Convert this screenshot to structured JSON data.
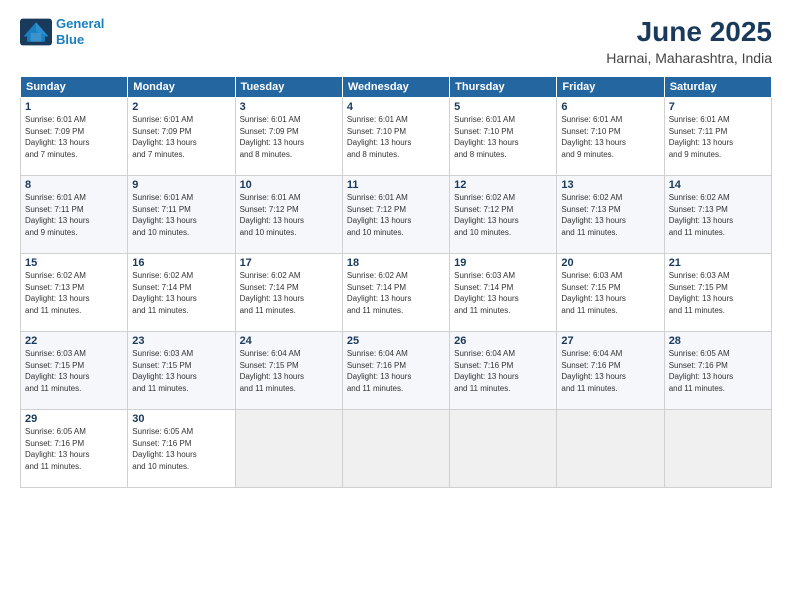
{
  "header": {
    "logo_line1": "General",
    "logo_line2": "Blue",
    "title": "June 2025",
    "subtitle": "Harnai, Maharashtra, India"
  },
  "weekdays": [
    "Sunday",
    "Monday",
    "Tuesday",
    "Wednesday",
    "Thursday",
    "Friday",
    "Saturday"
  ],
  "weeks": [
    [
      {
        "day": "1",
        "info": "Sunrise: 6:01 AM\nSunset: 7:09 PM\nDaylight: 13 hours\nand 7 minutes."
      },
      {
        "day": "2",
        "info": "Sunrise: 6:01 AM\nSunset: 7:09 PM\nDaylight: 13 hours\nand 7 minutes."
      },
      {
        "day": "3",
        "info": "Sunrise: 6:01 AM\nSunset: 7:09 PM\nDaylight: 13 hours\nand 8 minutes."
      },
      {
        "day": "4",
        "info": "Sunrise: 6:01 AM\nSunset: 7:10 PM\nDaylight: 13 hours\nand 8 minutes."
      },
      {
        "day": "5",
        "info": "Sunrise: 6:01 AM\nSunset: 7:10 PM\nDaylight: 13 hours\nand 8 minutes."
      },
      {
        "day": "6",
        "info": "Sunrise: 6:01 AM\nSunset: 7:10 PM\nDaylight: 13 hours\nand 9 minutes."
      },
      {
        "day": "7",
        "info": "Sunrise: 6:01 AM\nSunset: 7:11 PM\nDaylight: 13 hours\nand 9 minutes."
      }
    ],
    [
      {
        "day": "8",
        "info": "Sunrise: 6:01 AM\nSunset: 7:11 PM\nDaylight: 13 hours\nand 9 minutes."
      },
      {
        "day": "9",
        "info": "Sunrise: 6:01 AM\nSunset: 7:11 PM\nDaylight: 13 hours\nand 10 minutes."
      },
      {
        "day": "10",
        "info": "Sunrise: 6:01 AM\nSunset: 7:12 PM\nDaylight: 13 hours\nand 10 minutes."
      },
      {
        "day": "11",
        "info": "Sunrise: 6:01 AM\nSunset: 7:12 PM\nDaylight: 13 hours\nand 10 minutes."
      },
      {
        "day": "12",
        "info": "Sunrise: 6:02 AM\nSunset: 7:12 PM\nDaylight: 13 hours\nand 10 minutes."
      },
      {
        "day": "13",
        "info": "Sunrise: 6:02 AM\nSunset: 7:13 PM\nDaylight: 13 hours\nand 11 minutes."
      },
      {
        "day": "14",
        "info": "Sunrise: 6:02 AM\nSunset: 7:13 PM\nDaylight: 13 hours\nand 11 minutes."
      }
    ],
    [
      {
        "day": "15",
        "info": "Sunrise: 6:02 AM\nSunset: 7:13 PM\nDaylight: 13 hours\nand 11 minutes."
      },
      {
        "day": "16",
        "info": "Sunrise: 6:02 AM\nSunset: 7:14 PM\nDaylight: 13 hours\nand 11 minutes."
      },
      {
        "day": "17",
        "info": "Sunrise: 6:02 AM\nSunset: 7:14 PM\nDaylight: 13 hours\nand 11 minutes."
      },
      {
        "day": "18",
        "info": "Sunrise: 6:02 AM\nSunset: 7:14 PM\nDaylight: 13 hours\nand 11 minutes."
      },
      {
        "day": "19",
        "info": "Sunrise: 6:03 AM\nSunset: 7:14 PM\nDaylight: 13 hours\nand 11 minutes."
      },
      {
        "day": "20",
        "info": "Sunrise: 6:03 AM\nSunset: 7:15 PM\nDaylight: 13 hours\nand 11 minutes."
      },
      {
        "day": "21",
        "info": "Sunrise: 6:03 AM\nSunset: 7:15 PM\nDaylight: 13 hours\nand 11 minutes."
      }
    ],
    [
      {
        "day": "22",
        "info": "Sunrise: 6:03 AM\nSunset: 7:15 PM\nDaylight: 13 hours\nand 11 minutes."
      },
      {
        "day": "23",
        "info": "Sunrise: 6:03 AM\nSunset: 7:15 PM\nDaylight: 13 hours\nand 11 minutes."
      },
      {
        "day": "24",
        "info": "Sunrise: 6:04 AM\nSunset: 7:15 PM\nDaylight: 13 hours\nand 11 minutes."
      },
      {
        "day": "25",
        "info": "Sunrise: 6:04 AM\nSunset: 7:16 PM\nDaylight: 13 hours\nand 11 minutes."
      },
      {
        "day": "26",
        "info": "Sunrise: 6:04 AM\nSunset: 7:16 PM\nDaylight: 13 hours\nand 11 minutes."
      },
      {
        "day": "27",
        "info": "Sunrise: 6:04 AM\nSunset: 7:16 PM\nDaylight: 13 hours\nand 11 minutes."
      },
      {
        "day": "28",
        "info": "Sunrise: 6:05 AM\nSunset: 7:16 PM\nDaylight: 13 hours\nand 11 minutes."
      }
    ],
    [
      {
        "day": "29",
        "info": "Sunrise: 6:05 AM\nSunset: 7:16 PM\nDaylight: 13 hours\nand 11 minutes."
      },
      {
        "day": "30",
        "info": "Sunrise: 6:05 AM\nSunset: 7:16 PM\nDaylight: 13 hours\nand 10 minutes."
      },
      {
        "day": "",
        "info": ""
      },
      {
        "day": "",
        "info": ""
      },
      {
        "day": "",
        "info": ""
      },
      {
        "day": "",
        "info": ""
      },
      {
        "day": "",
        "info": ""
      }
    ]
  ]
}
